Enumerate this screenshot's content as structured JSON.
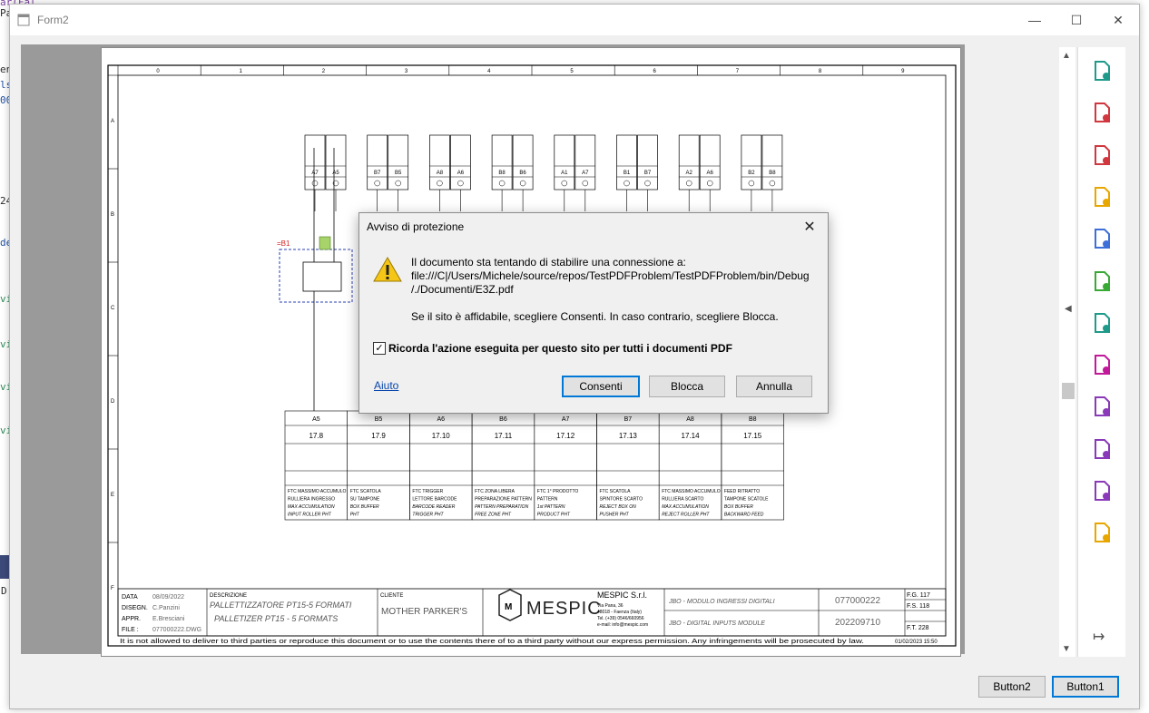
{
  "background": {
    "code_fragments": [
      "ar(Fal",
      "Pa",
      "en",
      "ls",
      "00",
      "24",
      "de",
      "vi",
      "vi",
      "vi",
      "vi",
      "D"
    ]
  },
  "window": {
    "title": "Form2",
    "minimize_label": "—",
    "maximize_label": "☐",
    "close_label": "✕"
  },
  "drawing": {
    "columns": [
      "0",
      "1",
      "2",
      "3",
      "4",
      "5",
      "6",
      "7",
      "8",
      "9"
    ],
    "rows": [
      "A",
      "B",
      "C",
      "D",
      "E",
      "F"
    ],
    "top_terminal_ids": [
      "A7",
      "A5",
      "B7",
      "B5",
      "A8",
      "A6",
      "B8",
      "B6",
      "A1",
      "A7",
      "B1",
      "B7",
      "A2",
      "A6",
      "B2",
      "B8"
    ],
    "device_label": "=B1",
    "slots": [
      "A5",
      "B5",
      "A6",
      "B6",
      "A7",
      "B7",
      "A8",
      "B8"
    ],
    "refs": [
      "17.8",
      "17.9",
      "17.10",
      "17.11",
      "17.12",
      "17.13",
      "17.14",
      "17.15"
    ],
    "descriptions": [
      [
        "FTC MASSIMO ACCUMULO",
        "RULLIERA INGRESSO",
        "MAX ACCUMULATION",
        "INPUT ROLLER PHT"
      ],
      [
        "FTC SCATOLA",
        "SU TAMPONE",
        "BOX BUFFER",
        "PHT"
      ],
      [
        "FTC TRIGGER",
        "LETTORE BARCODE",
        "BARCODE READER",
        "TRIGGER PHT"
      ],
      [
        "FTC ZONA LIBERA",
        "PREPARAZIONE PATTERN",
        "PATTERN PREPARATION",
        "FREE ZONE PHT"
      ],
      [
        "FTC 1° PRODOTTO",
        "PATTERN",
        "1st PATTERN",
        "PRODUCT PHT"
      ],
      [
        "FTC SCATOLA",
        "SPINTORE SCARTO",
        "REJECT BOX ON",
        "PUSHER PHT"
      ],
      [
        "FTC MASSIMO ACCUMULO",
        "RULLIERA SCARTO",
        "MAX ACCUMULATION",
        "REJECT ROLLER PHT"
      ],
      [
        "FEED RITRATTO",
        "TAMPONE SCATOLE",
        "BOX BUFFER",
        "BACKWARD FEED"
      ]
    ],
    "titleblock": {
      "data_label": "DATA",
      "data_value": "08/09/2022",
      "disegn_label": "DISEGN.",
      "disegn_value": "C.Panzini",
      "appr_label": "APPR.",
      "appr_value": "E.Bresciani",
      "file_label": "FILE :",
      "file_value": "077000222.DWG",
      "descrizione_label": "DESCRIZIONE",
      "descr_it": "PALLETTIZZATORE  PT15-5  FORMATI",
      "descr_en": "PALLETIZER  PT15  -  5  FORMATS",
      "cliente_label": "CLIENTE",
      "cliente_value": "MOTHER  PARKER'S",
      "logo_text": "MESPIC",
      "company": "MESPIC S.r.l.",
      "addr1": "Via Pana, 36",
      "addr2": "48018 - Faenza  (Italy)",
      "addr3": "Tel. (+39) 0546/660956",
      "addr4": "e-mail: info@mespic.com",
      "module_it": "JBO  -  MODULO  INGRESSI  DIGITALI",
      "module_en": "JBO  -  DIGITAL  INPUTS  MODULE",
      "code1": "077000222",
      "code2": "202209710",
      "fg": "F.G. 117",
      "fs": "F.S. 118",
      "ft": "F.T. 228"
    },
    "footer_text": "It is not allowed to deliver to third parties or reproduce this document or to use the contents there of to a third party without our express permission. Any infringements will be prosecuted by law.",
    "footer_date": "01/02/2023 15:50"
  },
  "dialog": {
    "title": "Avviso di protezione",
    "line1": "Il documento sta tentando di stabilire una connessione a:",
    "line2": "file:///C|/Users/Michele/source/repos/TestPDFProblem/TestPDFProblem/bin/Debug",
    "line3": "/./Documenti/E3Z.pdf",
    "line4": "Se il sito è affidabile, scegliere Consenti. In caso contrario, scegliere Blocca.",
    "checkbox_label": "Ricorda l'azione eseguita per questo sito per tutti i documenti PDF",
    "checkbox_checked": true,
    "help_link": "Aiuto",
    "allow_button": "Consenti",
    "block_button": "Blocca",
    "cancel_button": "Annulla"
  },
  "buttons": {
    "button2": "Button2",
    "button1": "Button1"
  },
  "tool_icons": [
    "export-pdf-icon",
    "organize-pages-icon",
    "create-pdf-icon",
    "comment-icon",
    "combine-files-icon",
    "compress-pdf-icon",
    "edit-pdf-icon",
    "fill-sign-icon",
    "protect-icon",
    "request-signature-icon",
    "sign-icon",
    "stamp-icon"
  ],
  "colors": {
    "accent": "#0078d7",
    "tool_colors": [
      "#1f9a8a",
      "#d1373f",
      "#d1373f",
      "#e8a700",
      "#3d6fd8",
      "#39a935",
      "#1f9a8a",
      "#c2189a",
      "#8a3ab9",
      "#8a3ab9",
      "#8a3ab9",
      "#e8a700"
    ]
  }
}
